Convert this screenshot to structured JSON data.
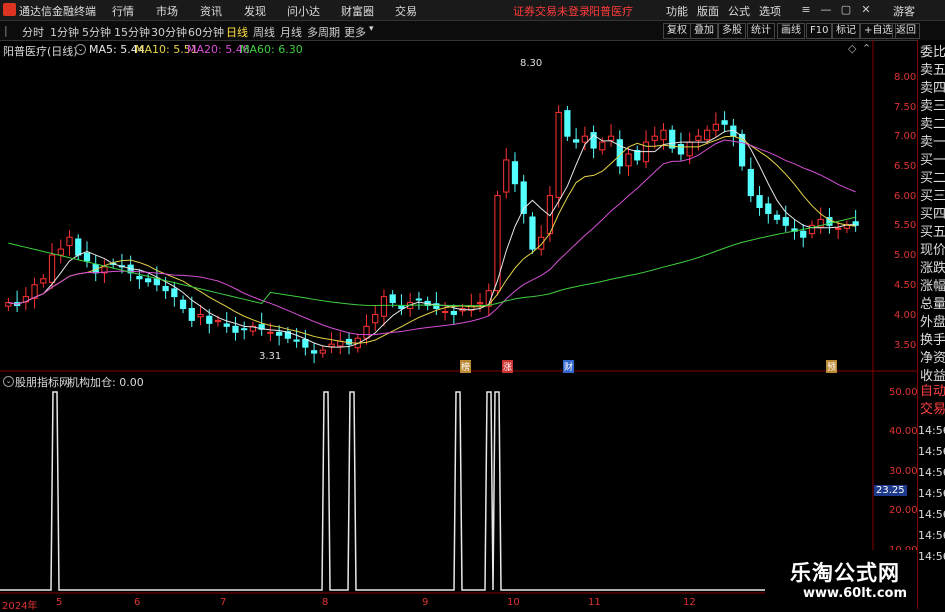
{
  "titlebar": {
    "app_name": "通达信金融终端",
    "menus": [
      "行情",
      "市场",
      "资讯",
      "发现",
      "问小达",
      "财富圈",
      "交易"
    ],
    "warning": "证券交易未登录",
    "stock_name": "阳普医疗",
    "right_menus": [
      "功能",
      "版面",
      "公式",
      "选项"
    ],
    "user": "游客"
  },
  "toolbar": {
    "periods": [
      "分时",
      "1分钟",
      "5分钟",
      "15分钟",
      "30分钟",
      "60分钟",
      "日线",
      "周线",
      "月线",
      "多周期",
      "更多"
    ],
    "active": "日线",
    "right_buttons": [
      "复权",
      "叠加",
      "多股",
      "统计",
      "画线",
      "F10",
      "标记",
      "+自选",
      "返回"
    ]
  },
  "main_chart": {
    "title": "阳普医疗(日线)",
    "ma_legend": [
      {
        "label": "MA5: 5.44",
        "color": "#e8e8e8"
      },
      {
        "label": "MA10: 5.51",
        "color": "#e6d44a"
      },
      {
        "label": "MA20: 5.48",
        "color": "#d64fd6"
      },
      {
        "label": "MA60: 6.30",
        "color": "#3fcf3f"
      }
    ],
    "high_label": "8.30",
    "low_label": "3.31",
    "markers": [
      "榜",
      "涨",
      "财",
      "预"
    ]
  },
  "indicator": {
    "title": "股朋指标网",
    "name": "机构加仓: 0.00",
    "current_value": "23.25"
  },
  "side_panel": {
    "items": [
      "委比",
      "卖五",
      "卖四",
      "卖三",
      "卖二",
      "卖一",
      "买一",
      "买二",
      "买三",
      "买四",
      "买五",
      "现价",
      "涨跌",
      "涨幅",
      "总量",
      "外盘",
      "换手",
      "净资",
      "收益"
    ],
    "items2": [
      "自动",
      "交易"
    ],
    "times": [
      "14:56",
      "14:56",
      "14:56",
      "14:56",
      "14:56",
      "14:56",
      "14:56"
    ]
  },
  "watermark": {
    "line1": "乐淘公式网",
    "line2": "www.60lt.com"
  },
  "chart_data": [
    {
      "type": "candlestick",
      "title": "阳普医疗(日线)",
      "y_ticks": [
        "8.00",
        "7.50",
        "7.00",
        "6.50",
        "6.00",
        "5.50",
        "5.00",
        "4.50",
        "4.00",
        "3.50"
      ],
      "ylim": [
        3.2,
        8.45
      ],
      "x_ticks": [
        "2024年",
        "5",
        "6",
        "7",
        "8",
        "9",
        "10",
        "11",
        "12"
      ],
      "close": [
        4.2,
        4.15,
        4.3,
        4.5,
        4.6,
        5.0,
        5.1,
        5.3,
        5.0,
        4.9,
        4.7,
        4.8,
        4.85,
        4.8,
        4.7,
        4.6,
        4.55,
        4.5,
        4.4,
        4.3,
        4.1,
        3.9,
        4.0,
        3.85,
        3.9,
        3.8,
        3.7,
        3.75,
        3.8,
        3.75,
        3.7,
        3.65,
        3.6,
        3.55,
        3.45,
        3.35,
        3.4,
        3.5,
        3.55,
        3.5,
        3.6,
        3.8,
        4.0,
        4.3,
        4.2,
        4.1,
        4.2,
        4.25,
        4.15,
        4.1,
        4.05,
        4.0,
        4.1,
        4.15,
        4.2,
        4.4,
        6.0,
        6.6,
        6.2,
        5.7,
        5.1,
        5.3,
        6.0,
        7.4,
        7.0,
        6.9,
        7.0,
        6.8,
        6.9,
        7.0,
        6.5,
        6.7,
        6.6,
        6.9,
        7.0,
        7.1,
        6.8,
        6.7,
        6.9,
        7.0,
        7.1,
        7.2,
        7.2,
        7.0,
        6.5,
        6.0,
        5.8,
        5.7,
        5.6,
        5.5,
        5.4,
        5.3,
        5.5,
        5.6,
        5.5,
        5.45,
        5.5,
        5.5
      ],
      "ma_legend": [
        "MA5: 5.44",
        "MA10: 5.51",
        "MA20: 5.48",
        "MA60: 6.30"
      ]
    },
    {
      "type": "line",
      "title": "机构加仓",
      "y_ticks": [
        "50.00",
        "40.00",
        "30.00",
        "20.00",
        "10.00"
      ],
      "ylim": [
        0,
        55
      ],
      "peaks": [
        {
          "x": "5",
          "value": 50
        },
        {
          "x": "8",
          "value": 50
        },
        {
          "x": "8",
          "value": 50
        },
        {
          "x": "9",
          "value": 50
        },
        {
          "x": "9",
          "value": 50
        },
        {
          "x": "10",
          "value": 50
        }
      ]
    }
  ]
}
